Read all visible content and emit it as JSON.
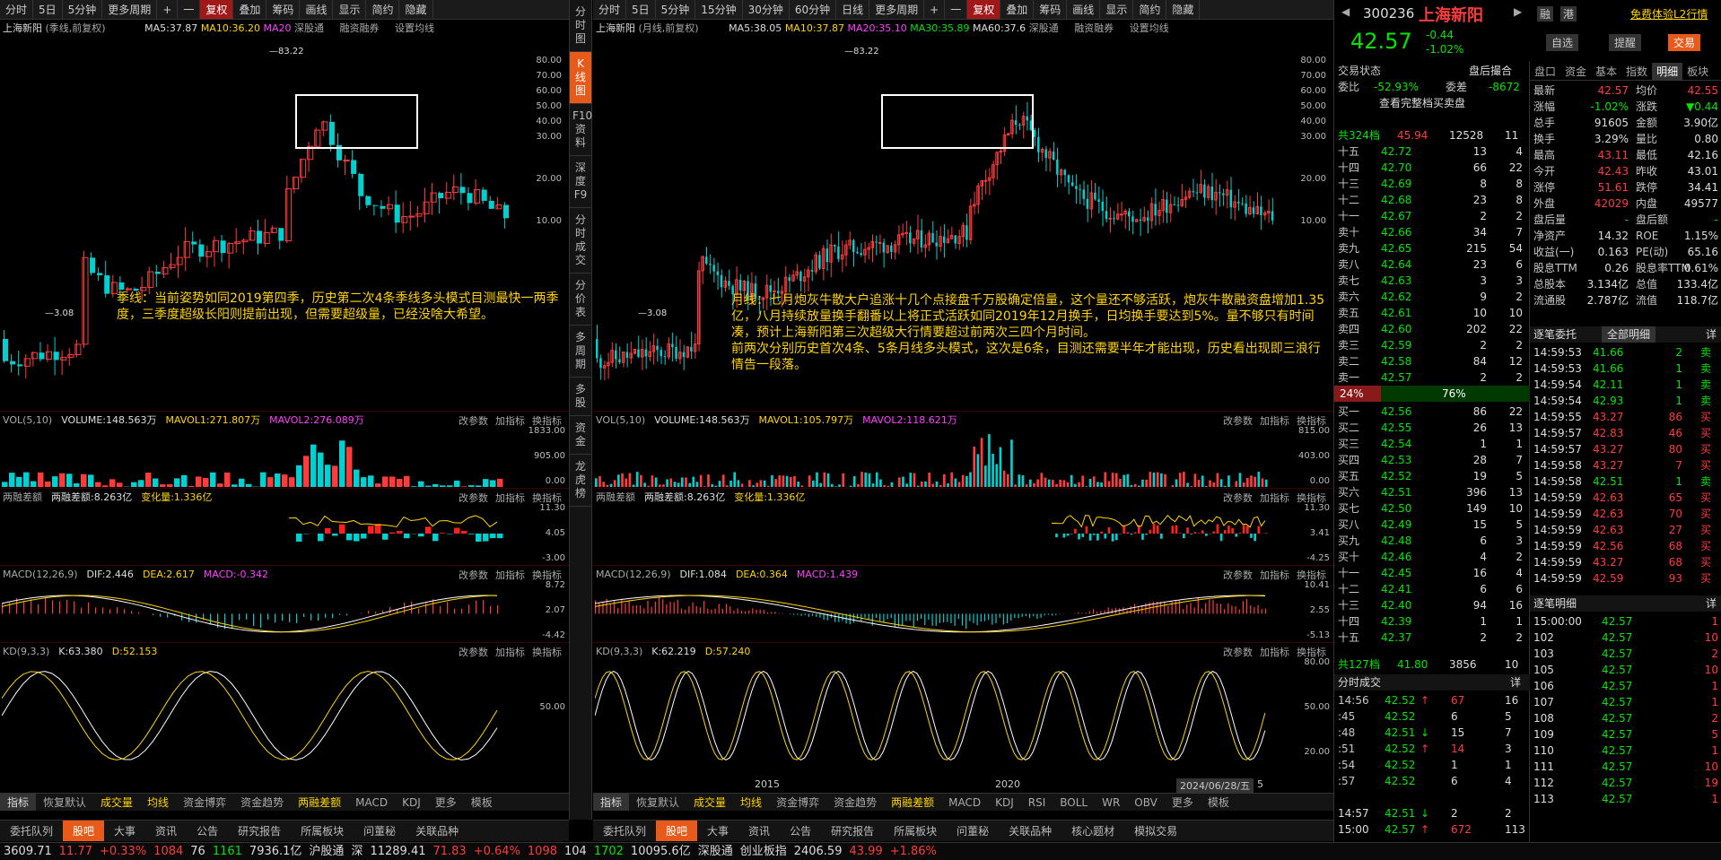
{
  "toolbar": {
    "left_items": [
      "分时",
      "5日",
      "5分钟",
      "更多周期",
      "+",
      "一",
      "复权",
      "叠加",
      "筹码",
      "画线",
      "显示",
      "简约",
      "隐藏"
    ],
    "right_items": [
      "分时",
      "5日",
      "5分钟",
      "15分钟",
      "30分钟",
      "60分钟",
      "日线",
      "更多周期",
      "+",
      "一",
      "复权",
      "叠加",
      "筹码",
      "画线",
      "显示",
      "简约",
      "隐藏"
    ]
  },
  "vertical_tabs": [
    "分时图",
    "K线图",
    "F10资料",
    "深度F9",
    "分时成交",
    "分价表",
    "多周期",
    "多股",
    "资金",
    "龙虎榜"
  ],
  "left_chart": {
    "title": "上海新阳",
    "period": "(季线,前复权)",
    "ma5": "MA5:37.87",
    "ma10": "MA10:36.20",
    "ma20": "MA20",
    "links": [
      "深股通",
      "融资融券",
      "设置均线"
    ],
    "peak_label": "83.22",
    "low_label": "3.08",
    "yaxis": [
      "80.00",
      "70.00",
      "60.00",
      "50.00",
      "40.00",
      "30.00",
      "20.00",
      "10.00"
    ],
    "annotation": "季线：当前姿势如同2019第四季，历史第二次4条季线多头模式目测最快一两季度，三季度超级长阳则提前出现，但需要超级量，已经没啥大希望。",
    "vol_hdr": [
      "VOL(5,10)",
      "VOLUME:148.563万",
      "MAVOL1:271.807万",
      "MAVOL2:276.089万"
    ],
    "vol_axis": [
      "1833.00",
      "905.00",
      "0.00"
    ],
    "margin_hdr": [
      "两融差额",
      "两融差额:8.263亿",
      "变化量:1.336亿"
    ],
    "margin_axis": [
      "11.30",
      "4.05",
      "-3.00"
    ],
    "macd_hdr": [
      "MACD(12,26,9)",
      "DIF:2.446",
      "DEA:2.617",
      "MACD:-0.342"
    ],
    "macd_axis": [
      "8.72",
      "2.07",
      "-4.42"
    ],
    "kd_hdr": [
      "KD(9,3,3)",
      "K:63.380",
      "D:52.153"
    ],
    "kd_axis": [
      "50.00"
    ]
  },
  "right_chart": {
    "title": "上海新阳",
    "period": "(月线,前复权)",
    "ma5": "MA5:38.05",
    "ma10": "MA10:37.87",
    "ma20": "MA20:35.10",
    "ma30": "MA30:35.89",
    "ma60": "MA60:37.6",
    "links": [
      "深股通",
      "融资融券",
      "设置均线"
    ],
    "peak_label": "83.22",
    "low_label": "3.08",
    "yaxis": [
      "80.00",
      "70.00",
      "60.00",
      "50.00",
      "40.00",
      "30.00",
      "20.00",
      "10.00"
    ],
    "annotation": [
      "月线：七月炮灰牛散大户追涨十几个点接盘千万股确定倍量，这个量还不够活跃，炮灰牛散融资盘增加1.35亿，八月持续放量换手翻番以上将正式活跃如同2019年12月换手，日均换手要达到5%。量不够只有时间凑，预计上海新阳第三次超级大行情要超过前两次三四个月时间。",
      "前两次分别历史首次4条、5条月线多头模式，这次是6条，目测还需要半年才能出现，历史看出现即三浪行情告一段落。"
    ],
    "vol_hdr": [
      "VOL(5,10)",
      "VOLUME:148.563万",
      "MAVOL1:105.797万",
      "MAVOL2:118.621万"
    ],
    "vol_axis": [
      "815.00",
      "403.00",
      "0.00"
    ],
    "margin_hdr": [
      "两融差额",
      "两融差额:8.263亿",
      "变化量:1.336亿"
    ],
    "margin_axis": [
      "11.30",
      "3.41",
      "-4.25"
    ],
    "macd_hdr": [
      "MACD(12,26,9)",
      "DIF:1.084",
      "DEA:0.364",
      "MACD:1.439"
    ],
    "macd_axis": [
      "10.41",
      "2.55",
      "-5.13"
    ],
    "kd_hdr": [
      "KD(9,3,3)",
      "K:62.219",
      "D:57.240"
    ],
    "kd_axis": [
      "80.00",
      "50.00",
      "20.00"
    ],
    "xaxis": [
      "2015",
      "2020"
    ],
    "date": "2024/06/28/五",
    "date_num": "5"
  },
  "panel_links": [
    "改参数",
    "加指标",
    "换指标"
  ],
  "bottom_tabs_left": [
    "指标",
    "恢复默认",
    "成交量",
    "均线",
    "资金博弈",
    "资金趋势",
    "两融差额",
    "MACD",
    "KDJ",
    "更多",
    "模板"
  ],
  "bottom_tabs_right": [
    "指标",
    "恢复默认",
    "成交量",
    "均线",
    "资金博弈",
    "资金趋势",
    "两融差额",
    "MACD",
    "KDJ",
    "RSI",
    "BOLL",
    "WR",
    "OBV",
    "更多",
    "模板"
  ],
  "nav_tabs_left": [
    "委托队列",
    "股吧",
    "大事",
    "资讯",
    "公告",
    "研究报告",
    "所属板块",
    "问董秘",
    "关联品种"
  ],
  "nav_tabs_right": [
    "委托队列",
    "股吧",
    "大事",
    "资讯",
    "公告",
    "研究报告",
    "所属板块",
    "问董秘",
    "关联品种",
    "核心题材",
    "模拟交易"
  ],
  "quote": {
    "code": "300236",
    "name": "上海新阳",
    "level2": "免费体验L2行情",
    "price": "42.57",
    "change": "-0.44",
    "pct": "-1.02%",
    "btns": [
      "融",
      "港",
      "自选",
      "提醒",
      "交易"
    ],
    "status_lbl": "交易状态",
    "status_val": "盘后撮合",
    "weibi": "委比",
    "weibi_val": "-52.93%",
    "weicha": "委差",
    "weicha_val": "-8672",
    "full": "查看完整档买卖盘",
    "sell_total": [
      "共324档",
      "45.94",
      "12528",
      "11"
    ],
    "buy_total": [
      "共127档",
      "41.80",
      "3856",
      "10"
    ],
    "ratio": [
      "24%",
      "76%"
    ],
    "sells": [
      [
        "十五",
        "42.72",
        "13",
        "4"
      ],
      [
        "十四",
        "42.70",
        "66",
        "22"
      ],
      [
        "十三",
        "42.69",
        "8",
        "8"
      ],
      [
        "十二",
        "42.68",
        "23",
        "8"
      ],
      [
        "十一",
        "42.67",
        "2",
        "2"
      ],
      [
        "卖十",
        "42.66",
        "34",
        "7"
      ],
      [
        "卖九",
        "42.65",
        "215",
        "54"
      ],
      [
        "卖八",
        "42.64",
        "23",
        "6"
      ],
      [
        "卖七",
        "42.63",
        "3",
        "3"
      ],
      [
        "卖六",
        "42.62",
        "9",
        "2"
      ],
      [
        "卖五",
        "42.61",
        "10",
        "10"
      ],
      [
        "卖四",
        "42.60",
        "202",
        "22"
      ],
      [
        "卖三",
        "42.59",
        "2",
        "2"
      ],
      [
        "卖二",
        "42.58",
        "84",
        "12"
      ],
      [
        "卖一",
        "42.57",
        "2",
        "2"
      ]
    ],
    "buys": [
      [
        "买一",
        "42.56",
        "86",
        "22"
      ],
      [
        "买二",
        "42.55",
        "26",
        "13"
      ],
      [
        "买三",
        "42.54",
        "1",
        "1"
      ],
      [
        "买四",
        "42.53",
        "28",
        "7"
      ],
      [
        "买五",
        "42.52",
        "19",
        "5"
      ],
      [
        "买六",
        "42.51",
        "396",
        "13"
      ],
      [
        "买七",
        "42.50",
        "149",
        "10"
      ],
      [
        "买八",
        "42.49",
        "15",
        "5"
      ],
      [
        "买九",
        "42.48",
        "6",
        "3"
      ],
      [
        "买十",
        "42.46",
        "4",
        "2"
      ],
      [
        "十一",
        "42.45",
        "16",
        "4"
      ],
      [
        "十二",
        "42.41",
        "6",
        "6"
      ],
      [
        "十三",
        "42.40",
        "94",
        "16"
      ],
      [
        "十四",
        "42.39",
        "1",
        "1"
      ],
      [
        "十五",
        "42.37",
        "2",
        "2"
      ]
    ],
    "ticks_title": "分时成交",
    "ticks_more": "详",
    "ticks": [
      [
        "14:56",
        "42.52",
        "↑",
        "67",
        "16"
      ],
      [
        ":45",
        "42.52",
        "",
        "6",
        "5"
      ],
      [
        ":48",
        "42.51",
        "↓",
        "15",
        "7"
      ],
      [
        ":51",
        "42.52",
        "↑",
        "14",
        "3"
      ],
      [
        ":54",
        "42.52",
        "",
        "1",
        "1"
      ],
      [
        ":57",
        "42.52",
        "",
        "6",
        "4"
      ]
    ],
    "ticks_bottom": [
      [
        "14:57",
        "42.51",
        "↓",
        "2",
        "2"
      ],
      [
        "15:00",
        "42.57",
        "↑",
        "672",
        "113"
      ]
    ],
    "tabs": [
      "盘口",
      "资金",
      "基本",
      "指数",
      "明细",
      "板块"
    ],
    "stats": [
      [
        "最新",
        "42.57",
        "均价",
        "42.55"
      ],
      [
        "涨幅",
        "-1.02%",
        "涨跌",
        "▼0.44"
      ],
      [
        "总手",
        "91605",
        "金额",
        "3.90亿"
      ],
      [
        "换手",
        "3.29%",
        "量比",
        "0.80"
      ],
      [
        "最高",
        "43.11",
        "最低",
        "42.16"
      ],
      [
        "今开",
        "42.43",
        "昨收",
        "43.01"
      ],
      [
        "涨停",
        "51.61",
        "跌停",
        "34.41"
      ],
      [
        "外盘",
        "42029",
        "内盘",
        "49577"
      ],
      [
        "盘后量",
        "-",
        "盘后额",
        "-"
      ],
      [
        "净资产",
        "14.32",
        "ROE",
        "1.15%"
      ],
      [
        "收益(一)",
        "0.163",
        "PE(动)",
        "65.16"
      ],
      [
        "股息TTM",
        "0.26",
        "股息率TTM",
        "0.61%"
      ],
      [
        "总股本",
        "3.134亿",
        "总值",
        "133.4亿"
      ],
      [
        "流通股",
        "2.787亿",
        "流值",
        "118.7亿"
      ]
    ],
    "detail_title": "逐笔委托",
    "detail_sel": "全部明细",
    "detail_more": "详",
    "details": [
      [
        "14:59:53",
        "41.66",
        "2",
        "卖"
      ],
      [
        "14:59:53",
        "41.66",
        "1",
        "卖"
      ],
      [
        "14:59:54",
        "42.11",
        "1",
        "卖"
      ],
      [
        "14:59:54",
        "42.93",
        "1",
        "卖"
      ],
      [
        "14:59:55",
        "43.27",
        "86",
        "买"
      ],
      [
        "14:59:57",
        "42.83",
        "46",
        "买"
      ],
      [
        "14:59:57",
        "43.27",
        "80",
        "买"
      ],
      [
        "14:59:58",
        "43.27",
        "7",
        "买"
      ],
      [
        "14:59:58",
        "42.51",
        "1",
        "卖"
      ],
      [
        "14:59:59",
        "42.63",
        "65",
        "买"
      ],
      [
        "14:59:59",
        "42.63",
        "70",
        "买"
      ],
      [
        "14:59:59",
        "42.63",
        "27",
        "买"
      ],
      [
        "14:59:59",
        "42.56",
        "68",
        "买"
      ],
      [
        "14:59:59",
        "43.27",
        "68",
        "买"
      ],
      [
        "14:59:59",
        "42.59",
        "93",
        "买"
      ]
    ],
    "deals_title": "逐笔明细",
    "deals_more": "详",
    "deals": [
      [
        "15:00:00",
        "42.57",
        "1"
      ],
      [
        "102",
        "42.57",
        "10"
      ],
      [
        "103",
        "42.57",
        "2"
      ],
      [
        "105",
        "42.57",
        "10"
      ],
      [
        "106",
        "42.57",
        "1"
      ],
      [
        "107",
        "42.57",
        "1"
      ],
      [
        "108",
        "42.57",
        "2"
      ],
      [
        "109",
        "42.57",
        "5"
      ],
      [
        "110",
        "42.57",
        "1"
      ],
      [
        "111",
        "42.57",
        "10"
      ],
      [
        "112",
        "42.57",
        "19"
      ],
      [
        "113",
        "42.57",
        "1"
      ]
    ]
  },
  "status_bar": [
    "3609.71",
    "11.77",
    "+0.33%",
    "1084",
    "76",
    "1161",
    "7936.1亿",
    "沪股通",
    "深",
    "11289.41",
    "71.83",
    "+0.64%",
    "1098",
    "104",
    "1702",
    "10095.6亿",
    "深股通",
    "创业板指",
    "2406.59",
    "43.99",
    "+1.86%"
  ]
}
